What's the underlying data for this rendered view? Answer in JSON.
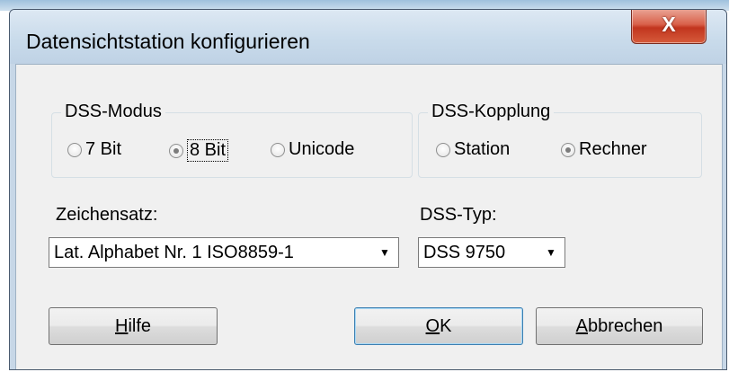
{
  "window": {
    "title": "Datensichtstation  konfigurieren",
    "close_glyph": "X"
  },
  "dss_modus": {
    "title": "DSS-Modus",
    "options": [
      {
        "label": "7 Bit",
        "checked": false
      },
      {
        "label": "8 Bit",
        "checked": true
      },
      {
        "label": "Unicode",
        "checked": false
      }
    ]
  },
  "dss_kopplung": {
    "title": "DSS-Kopplung",
    "options": [
      {
        "label": "Station",
        "checked": false
      },
      {
        "label": "Rechner",
        "checked": true
      }
    ]
  },
  "zeichensatz": {
    "label": "Zeichensatz:",
    "value": "Lat. Alphabet Nr. 1 ISO8859-1"
  },
  "dss_typ": {
    "label": "DSS-Typ:",
    "value": "DSS 9750"
  },
  "buttons": {
    "hilfe": {
      "mnemonic": "H",
      "rest": "ilfe"
    },
    "ok": {
      "mnemonic": "O",
      "rest": "K"
    },
    "abbrechen": {
      "mnemonic": "A",
      "rest": "bbrechen"
    }
  },
  "icons": {
    "combo_arrow": "chevron-down-icon",
    "close": "close-icon"
  },
  "colors": {
    "client_bg": "#f0f0f0",
    "frame_bg": "#c7d7e7",
    "close_red": "#c1351e",
    "default_button_border": "#3c7fb1"
  }
}
